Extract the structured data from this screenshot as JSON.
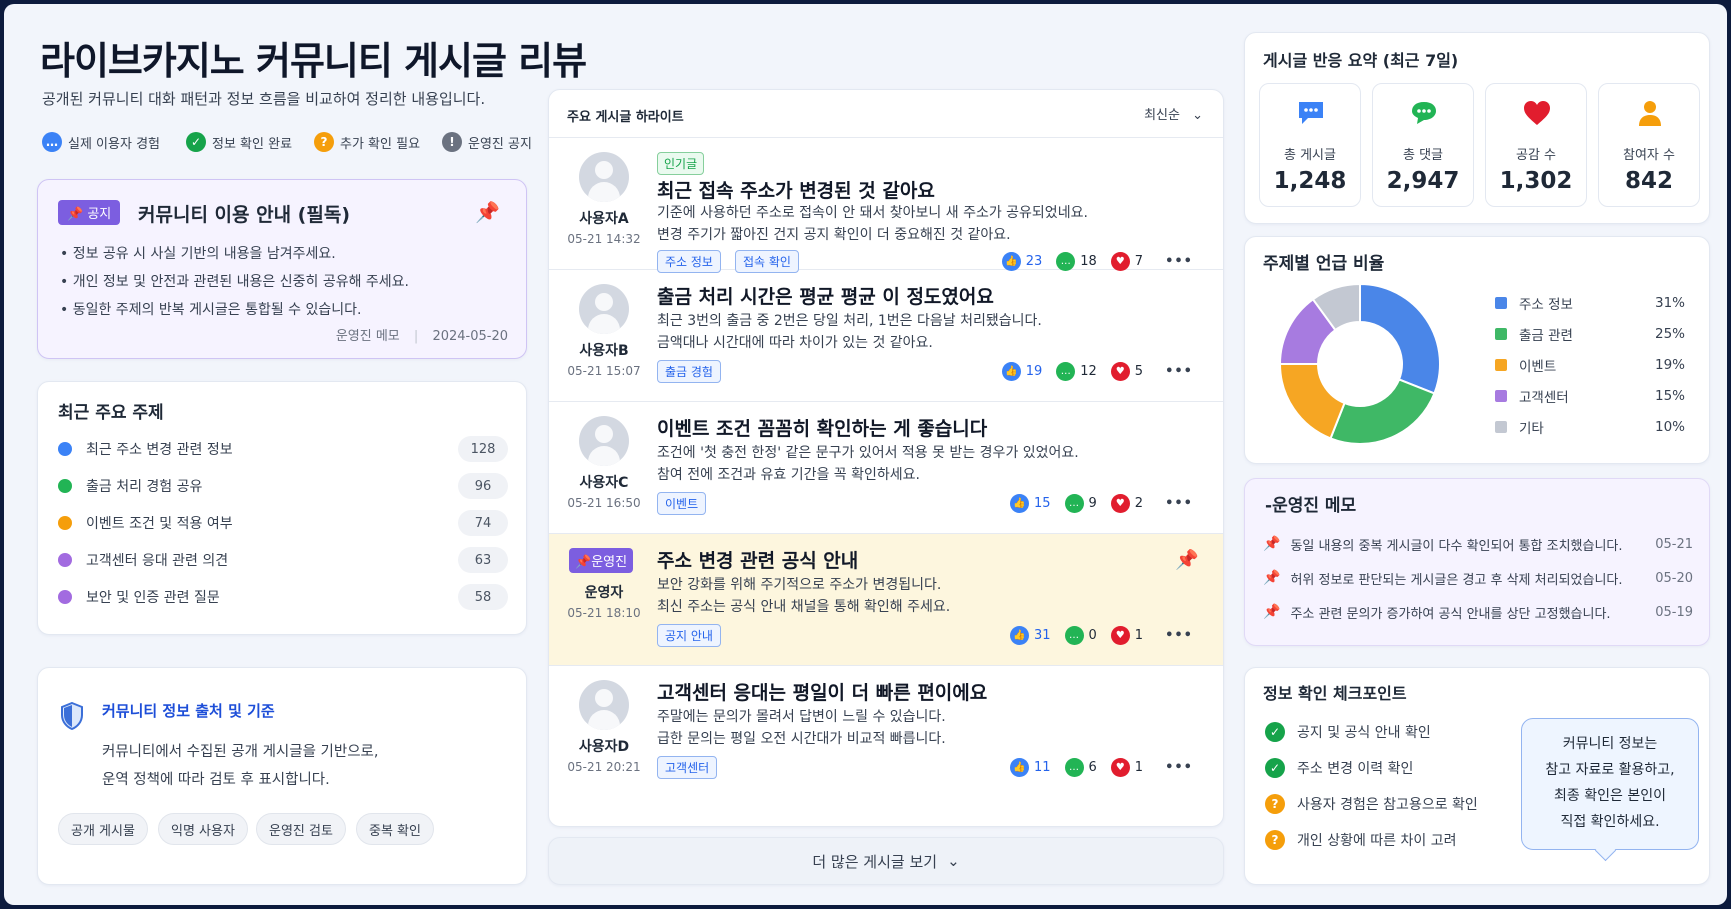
{
  "header": {
    "title": "라이브카지노 커뮤니티 게시글 리뷰",
    "subtitle": "공개된 커뮤니티 대화 패턴과 정보 흐름을 비교하여 정리한 내용입니다.",
    "legend": [
      {
        "label": "실제 이용자 경험",
        "icon": "chat-icon",
        "color": "#3b82f6"
      },
      {
        "label": "정보 확인 완료",
        "icon": "check-icon",
        "color": "#16a34a"
      },
      {
        "label": "추가 확인 필요",
        "icon": "question-icon",
        "color": "#f59e0b"
      },
      {
        "label": "운영진 공지",
        "icon": "alert-icon",
        "color": "#6b7280"
      }
    ]
  },
  "notice": {
    "tag": "공지",
    "title": "커뮤니티 이용 안내 (필독)",
    "bullets": [
      "정보 공유 시 사실 기반의 내용을 남겨주세요.",
      "개인 정보 및 안전과 관련된 내용은 신중히 공유해 주세요.",
      "동일한 주제의 반복 게시글은 통합될 수 있습니다."
    ],
    "footer_author": "운영진 메모",
    "footer_date": "2024-05-20"
  },
  "topics": {
    "title": "최근 주요 주제",
    "items": [
      {
        "label": "최근 주소 변경 관련 정보",
        "count": "128",
        "color": "#3b82f6"
      },
      {
        "label": "출금 처리 경험 공유",
        "count": "96",
        "color": "#22b455"
      },
      {
        "label": "이벤트 조건 및 적용 여부",
        "count": "74",
        "color": "#f59e0b"
      },
      {
        "label": "고객센터 응대 관련 의견",
        "count": "63",
        "color": "#a26be0"
      },
      {
        "label": "보안 및 인증 관련 질문",
        "count": "58",
        "color": "#a26be0"
      }
    ]
  },
  "source": {
    "title": "커뮤니티 정보 출처 및 기준",
    "line1": "커뮤니티에서 수집된 공개 게시글을 기반으로,",
    "line2": "운역 정책에 따라 검토 후 표시합니다.",
    "chips": [
      "공개 게시물",
      "익명 사용자",
      "운영진 검토",
      "중복 확인"
    ]
  },
  "posts": {
    "section_title": "주요 게시글 하라이트",
    "sort": "최신순",
    "more_label": "더 많은 게시글 보기",
    "items": [
      {
        "user": "사용자A",
        "date": "05-21 14:32",
        "badge": "인기글",
        "title": "최근 접속 주소가 변경된 것 같아요",
        "body1": "기준에 사용하던 주소로 접속이 안 돼서 찾아보니 새 주소가 공유되었네요.",
        "body2": "변경 주기가 짧아진 건지 공지 확인이 더 중요해진 것 같아요.",
        "tags": [
          "주소 정보",
          "접속 확인"
        ],
        "likes": "23",
        "comments": "18",
        "hearts": "7"
      },
      {
        "user": "사용자B",
        "date": "05-21 15:07",
        "title": "출금 처리 시간은 평균 평균 이 정도였어요",
        "body1": "최근 3번의 출금 중 2번은 당일 처리, 1번은 다음날 처리됐습니다.",
        "body2": "금액대나 시간대에 따라 차이가 있는 것 같아요.",
        "tags": [
          "출금 경험"
        ],
        "likes": "19",
        "comments": "12",
        "hearts": "5"
      },
      {
        "user": "사용자C",
        "date": "05-21 16:50",
        "title": "이벤트 조건 꼼꼼히 확인하는 게 좋습니다",
        "body1": "조건에 '첫 충전 한정' 같은 문구가 있어서 적용 못 받는 경우가 있었어요.",
        "body2": "참여 전에 조건과 유효 기간을 꼭 확인하세요.",
        "tags": [
          "이벤트"
        ],
        "likes": "15",
        "comments": "9",
        "hearts": "2"
      },
      {
        "user": "운영자",
        "date": "05-21 18:10",
        "official_tag": "운영진",
        "title": "주소 변경 관련 공식 안내",
        "body1": "보안 강화를 위해 주기적으로 주소가 변경됩니다.",
        "body2": "최신 주소는 공식 안내 채널을 통해 확인해 주세요.",
        "tags": [
          "공지 안내"
        ],
        "likes": "31",
        "comments": "0",
        "hearts": "1"
      },
      {
        "user": "사용자D",
        "date": "05-21 20:21",
        "title": "고객센터 응대는 평일이 더 빠른 편이에요",
        "body1": "주말에는 문의가 몰려서 답변이 느릴 수 있습니다.",
        "body2": "급한 문의는 평일 오전 시간대가 비교적 빠릅니다.",
        "tags": [
          "고객센터"
        ],
        "likes": "11",
        "comments": "6",
        "hearts": "1"
      }
    ]
  },
  "summary": {
    "title": "게시글 반응 요약 (최근 7일)",
    "stats": [
      {
        "label": "총 게시글",
        "value": "1,248",
        "icon": "chat-bubble-icon",
        "color": "#3b82f6"
      },
      {
        "label": "총 댓글",
        "value": "2,947",
        "icon": "comment-icon",
        "color": "#22b455"
      },
      {
        "label": "공감 수",
        "value": "1,302",
        "icon": "heart-icon",
        "color": "#e11d2e"
      },
      {
        "label": "참여자 수",
        "value": "842",
        "icon": "person-icon",
        "color": "#f59e0b"
      }
    ]
  },
  "chart_data": {
    "type": "pie",
    "title": "주제별 언급 비율",
    "categories": [
      "주소 정보",
      "출금 관련",
      "이벤트",
      "고객센터",
      "기타"
    ],
    "values": [
      31,
      25,
      19,
      15,
      10
    ],
    "labels": [
      "31%",
      "25%",
      "19%",
      "15%",
      "10%"
    ],
    "colors": [
      "#4a86e8",
      "#3fb866",
      "#f6a623",
      "#a77be0",
      "#c3c8d2"
    ],
    "legend": "right"
  },
  "memo": {
    "title": "운영진 메모",
    "items": [
      {
        "text": "동일 내용의 중복 게시글이 다수 확인되어 통합 조치했습니다.",
        "date": "05-21"
      },
      {
        "text": "허위 정보로 판단되는 게시글은 경고 후 삭제 처리되었습니다.",
        "date": "05-20"
      },
      {
        "text": "주소 관련 문의가 증가하여 공식 안내를 상단 고정했습니다.",
        "date": "05-19"
      }
    ]
  },
  "checkpoints": {
    "title": "정보 확인 체크포인트",
    "items": [
      {
        "label": "공지 및 공식 안내 확인",
        "status": "ok"
      },
      {
        "label": "주소 변경 이력 확인",
        "status": "ok"
      },
      {
        "label": "사용자 경험은 참고용으로 확인",
        "status": "warn"
      },
      {
        "label": "개인 상황에 따른 차이 고려",
        "status": "warn"
      }
    ],
    "bubble": [
      "커뮤니티 정보는",
      "참고 자료로 활용하고,",
      "최종 확인은 본인이",
      "직접 확인하세요."
    ]
  }
}
